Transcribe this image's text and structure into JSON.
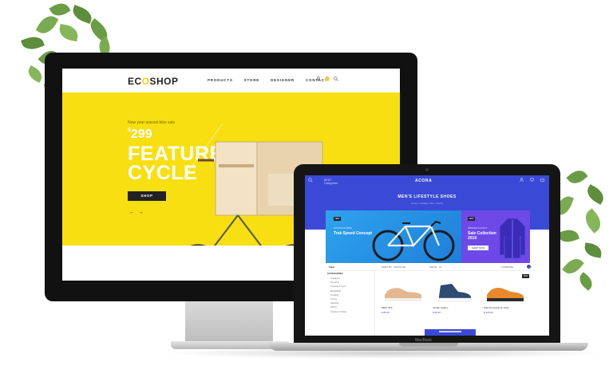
{
  "monitor": {
    "site": {
      "logo_prefix": "EC",
      "logo_o": "O",
      "logo_suffix": "SHOP",
      "nav": [
        "PRODUCTS",
        "STORE",
        "DESIGNER",
        "CONTACT"
      ],
      "hero_small_text": "New year special bike sale",
      "currency": "$",
      "price": "299",
      "title_line1": "FEATURED",
      "title_line2": "CYCLE",
      "shop_button": "SHOP",
      "prev_arrow": "←",
      "next_arrow": "→",
      "icons": [
        "user-icon",
        "cart-icon",
        "search-icon"
      ]
    },
    "colors": {
      "hero_bg": "#f7df11",
      "bezel": "#111111"
    }
  },
  "laptop": {
    "brand_label": "MacBook",
    "site": {
      "logo": "ACORA",
      "header_categories_top": "BEST",
      "header_categories_bottom": "Categories",
      "page_title": "MEN'S LIFESTYLE SHOES",
      "breadcrumb": "Home  /  Catalog  /  Men  /  Shoes",
      "banner1": {
        "tag": "NEW",
        "label": "SPORTIVE BIKE",
        "title": "Trek Speed Concept"
      },
      "banner2": {
        "tag": "NEW",
        "label": "WINTER JACKET",
        "title_line1": "Sale Collection",
        "title_line2": "2019",
        "button": "SHOP NOW"
      },
      "toolbar": {
        "filter": "Filter",
        "sort": "SORT BY · POPULAR",
        "show": "SHOW · 12",
        "compare": "COMPARE"
      },
      "sidebar": {
        "heading": "CATEGORIES",
        "items": [
          "Sneakers",
          "Running",
          "Training & Gym",
          "Basketball",
          "Football",
          "Tennis",
          "Sandals",
          "Hiking",
          "Outdoor & Wear"
        ]
      },
      "products": [
        {
          "name": "NEW OFF",
          "price": "$ 89.00"
        },
        {
          "name": "Jordan Galaxy",
          "price": "$ 99.00"
        },
        {
          "name": "Nike Air Huarache Ultra",
          "price": "$ 105.00",
          "tag": "NEW"
        }
      ]
    },
    "colors": {
      "primary": "#3b4ad6",
      "banner_blue": "#2ea3ee",
      "banner_purple": "#6e49e8"
    }
  }
}
